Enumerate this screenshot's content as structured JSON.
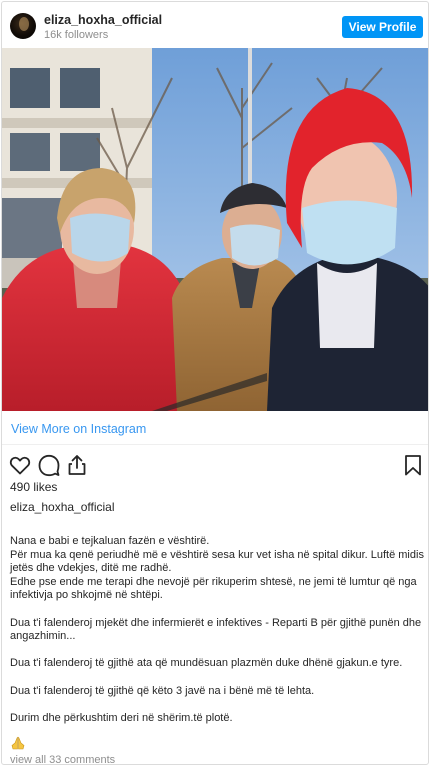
{
  "header": {
    "username": "eliza_hoxha_official",
    "followers": "16k followers",
    "view_profile_label": "View Profile"
  },
  "post": {
    "view_more_label": "View More on Instagram",
    "likes": "490 likes",
    "caption_username": "eliza_hoxha_official",
    "caption_lines": [
      "Nana e babi e tejkaluan fazën e vështirë.",
      "Për mua ka qenë periudhë më e vështirë sesa kur vet isha në spital dikur. Luftë midis jetës dhe vdekjes, ditë me radhë.",
      "Edhe pse ende me terapi dhe nevojë për rikuperim shtesë, ne jemi të lumtur që nga infektivja po shkojmë në shtëpi.",
      "",
      "Dua t'i falenderoj mjekët dhe infermierët e infektives - Reparti B për gjithë punën dhe angazhimin...",
      "",
      "Dua t'i falenderoj të gjithë ata që mundësuan plazmën duke dhënë gjakun.e tyre.",
      "",
      "Dua t'i falenderoj të gjithë që këto 3 javë na i bënë më të lehta.",
      "",
      "Durim dhe përkushtim deri në shërim.të plotë."
    ],
    "view_comments_label": "view all 33 comments"
  },
  "icons": {
    "like": "heart-icon",
    "comment": "comment-icon",
    "share": "share-icon",
    "save": "bookmark-icon",
    "emoji": "folded-hands-icon"
  },
  "colors": {
    "accent": "#0095f6",
    "link": "#3897f0",
    "muted": "#8e8e8e",
    "text": "#262626"
  }
}
